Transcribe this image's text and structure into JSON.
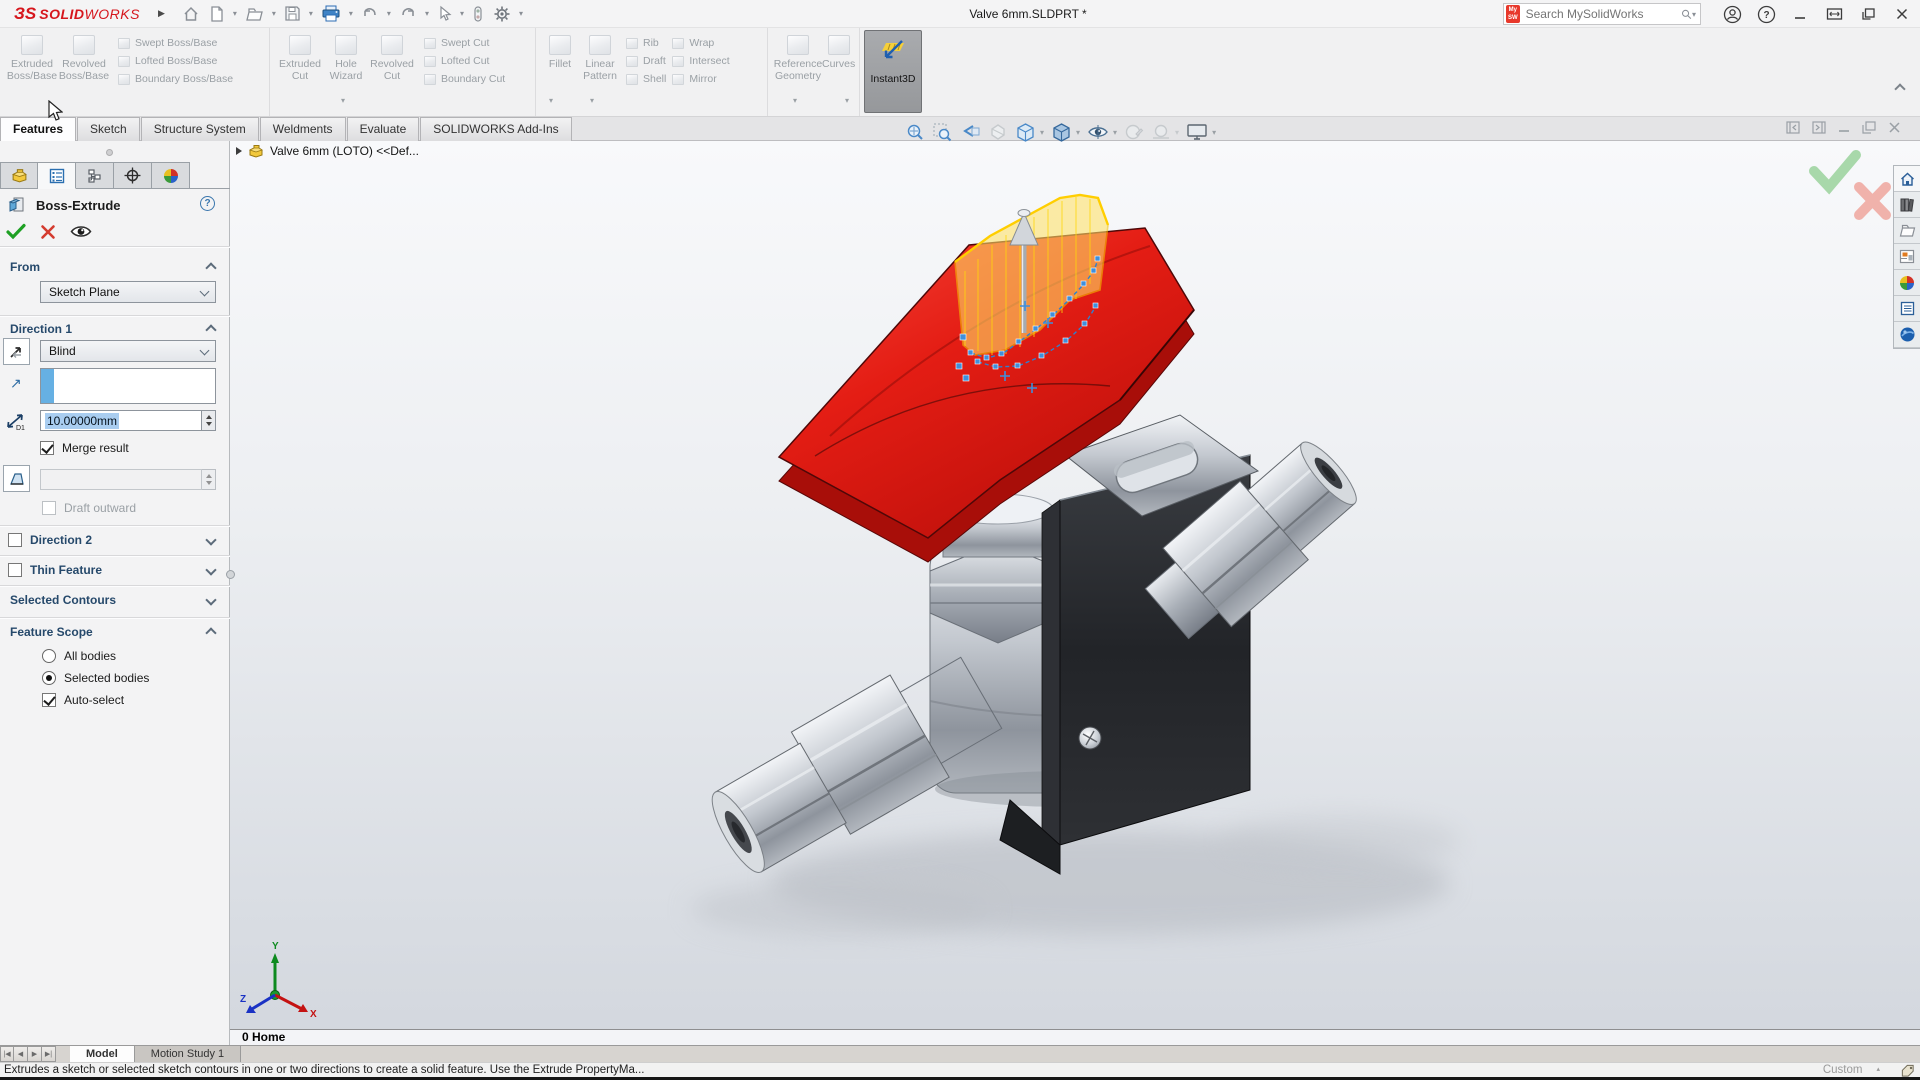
{
  "title_bar": {
    "app_name_mark": "ЗS",
    "app_name_solid": "SOLID",
    "app_name_works": "WORKS",
    "document_title": "Valve 6mm.SLDPRT *",
    "search_placeholder": "Search MySolidWorks",
    "mysw_badge_line1": "My",
    "mysw_badge_line2": "SW",
    "quick_access_icons": [
      "home",
      "new-document",
      "open",
      "save",
      "print",
      "undo",
      "redo",
      "select",
      "rebuild",
      "options"
    ]
  },
  "ribbon": {
    "groups": [
      {
        "big": [
          "Extruded Boss/Base",
          "Revolved Boss/Base"
        ],
        "stack": [
          "Swept Boss/Base",
          "Lofted Boss/Base",
          "Boundary Boss/Base"
        ]
      },
      {
        "big": [
          "Extruded Cut",
          "Hole Wizard",
          "Revolved Cut"
        ],
        "stack": [
          "Swept Cut",
          "Lofted Cut",
          "Boundary Cut"
        ]
      },
      {
        "big": [
          "Fillet",
          "Linear Pattern"
        ],
        "stack": [
          "Rib",
          "Draft",
          "Shell"
        ],
        "stack2": [
          "Wrap",
          "Intersect",
          "Mirror"
        ]
      },
      {
        "big": [
          "Reference Geometry",
          "Curves"
        ]
      },
      {
        "big": [
          "Instant3D"
        ]
      }
    ]
  },
  "command_tabs": {
    "items": [
      "Features",
      "Sketch",
      "Structure System",
      "Weldments",
      "Evaluate",
      "SOLIDWORKS Add-Ins"
    ],
    "active": "Features"
  },
  "feature_tree": {
    "root_label": "Valve 6mm (LOTO) <<Def..."
  },
  "property_manager": {
    "title": "Boss-Extrude",
    "from": {
      "header": "From",
      "start_condition": "Sketch Plane"
    },
    "direction1": {
      "header": "Direction 1",
      "end_condition": "Blind",
      "depth": "10.00000mm",
      "merge_result_label": "Merge result",
      "draft_outward_label": "Draft outward"
    },
    "direction2": {
      "header": "Direction 2"
    },
    "thin_feature": {
      "header": "Thin Feature"
    },
    "selected_contours": {
      "header": "Selected Contours"
    },
    "feature_scope": {
      "header": "Feature Scope",
      "all_bodies": "All bodies",
      "selected_bodies": "Selected bodies",
      "auto_select": "Auto-select",
      "selected_option": "Selected bodies"
    }
  },
  "viewport": {
    "view_label": "0 Home",
    "triad": {
      "x_label": "X",
      "y_label": "Y",
      "z_label": "Z"
    },
    "headsup_icons": [
      "zoom-to-fit",
      "zoom-to-area",
      "previous-view",
      "section-view",
      "view-orientation",
      "display-style",
      "hide-show-items",
      "edit-appearance",
      "apply-scene",
      "view-settings"
    ],
    "model_colors": {
      "handle_red": "#e41d14",
      "preview_yellow": "#ffe267",
      "sketch_blue": "#3f8fdc",
      "bracket_black": "#222428",
      "steel": "#b9bfc7"
    }
  },
  "task_pane_icons": [
    "home",
    "design-library",
    "file-explorer",
    "view-palette",
    "appearances-scenes",
    "custom-properties",
    "3dexperience"
  ],
  "bottom_tabs": {
    "items": [
      "Model",
      "Motion Study 1"
    ],
    "active": "Model"
  },
  "status_bar": {
    "message": "Extrudes a sketch or selected sketch contours in one or two directions to create a solid feature. Use the Extrude PropertyMa...",
    "units": "Custom"
  }
}
